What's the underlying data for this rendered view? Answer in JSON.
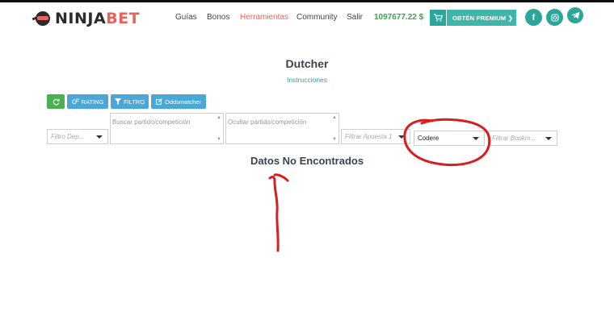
{
  "header": {
    "logo": {
      "part1": "NINJA",
      "part2": "BET"
    },
    "nav": [
      "Guías",
      "Bonos",
      "Herramientas",
      "Community",
      "Salir"
    ],
    "balance": "1097677.22 $",
    "premium_label": "OBTÉN PREMIUM ❯",
    "social": [
      "facebook-icon",
      "instagram-icon",
      "telegram-icon"
    ]
  },
  "main": {
    "title": "Dutcher",
    "instructions_link": "Instrucciones",
    "toolbar": {
      "rating_label": "RATING",
      "filtro_label": "FILTRO",
      "odds_label": "Oddsmatcher"
    },
    "filters": {
      "deporte_placeholder": "Filtro Dep...",
      "buscar_placeholder": "Buscar partido/competición",
      "ocultar_placeholder": "Ocultar partido/competición",
      "apuesta_placeholder": "Filtrar Apuesta 1",
      "bookmaker_selected": "Codere",
      "bookmaker2_placeholder": "Filtrar Bookm..."
    },
    "empty_message": "Datos No Encontrados"
  },
  "colors": {
    "brand_red": "#e8635a",
    "brand_teal": "#2aa79a",
    "balance_green": "#3aa655",
    "button_blue": "#4aa8d8",
    "refresh_green": "#4caf50",
    "annotation_red": "#d71f1f"
  }
}
